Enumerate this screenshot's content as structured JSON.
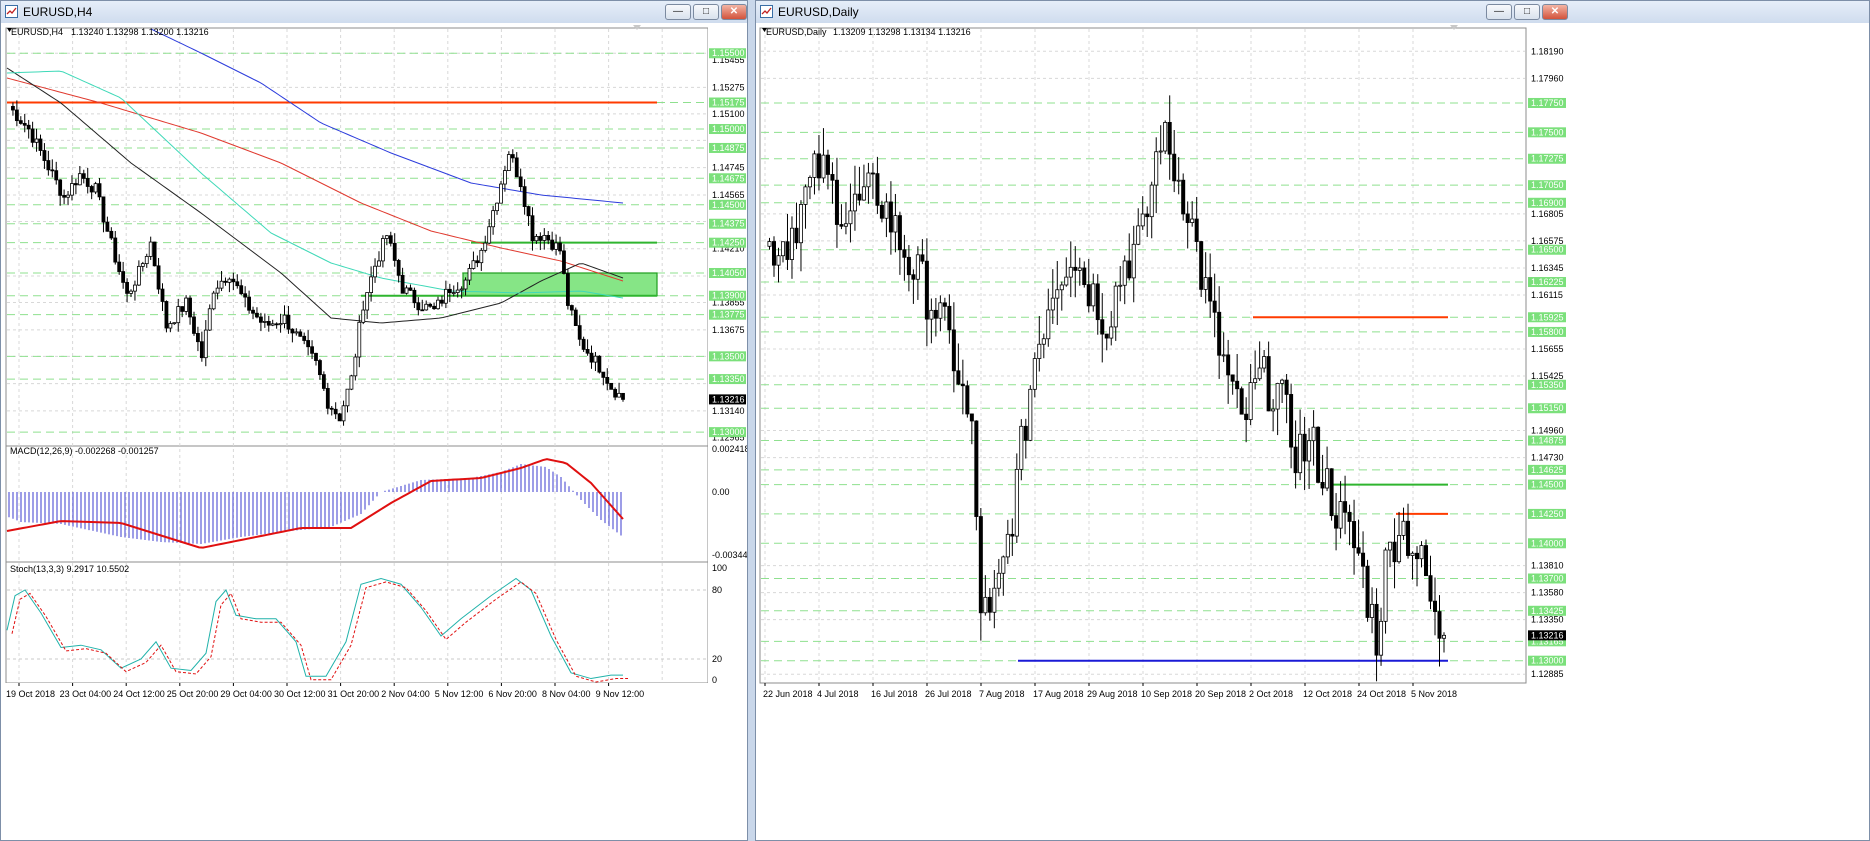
{
  "left": {
    "window_title": "EURUSD,H4",
    "header_symbol": "EURUSD,H4",
    "header_ohlc": "1.13240 1.13298 1.13200 1.13216",
    "macd_label": "MACD(12,26,9) -0.002268 -0.001257",
    "macd_scale": [
      "0.002418",
      "0.00",
      "-0.00344"
    ],
    "stoch_label": "Stoch(13,3,3) 9.2917 10.5502",
    "stoch_scale": [
      "100",
      "80",
      "20",
      "0"
    ],
    "price_labels": [
      {
        "text": "1.15455",
        "kind": "plain",
        "price": 1.15455
      },
      {
        "text": "1.15275",
        "kind": "plain",
        "price": 1.15275
      },
      {
        "text": "1.15100",
        "kind": "plain",
        "price": 1.151
      },
      {
        "text": "1.14745",
        "kind": "plain",
        "price": 1.14745
      },
      {
        "text": "1.14565",
        "kind": "plain",
        "price": 1.14565
      },
      {
        "text": "1.14210",
        "kind": "plain",
        "price": 1.1421
      },
      {
        "text": "1.13855",
        "kind": "plain",
        "price": 1.13855
      },
      {
        "text": "1.13675",
        "kind": "plain",
        "price": 1.13675
      },
      {
        "text": "1.13140",
        "kind": "plain",
        "price": 1.1314
      },
      {
        "text": "1.12965",
        "kind": "plain",
        "price": 1.12965
      },
      {
        "text": "1.15500",
        "kind": "green",
        "price": 1.155
      },
      {
        "text": "1.15175",
        "kind": "green",
        "price": 1.15175
      },
      {
        "text": "1.15000",
        "kind": "green",
        "price": 1.15
      },
      {
        "text": "1.14875",
        "kind": "green",
        "price": 1.14875
      },
      {
        "text": "1.14675",
        "kind": "green",
        "price": 1.14675
      },
      {
        "text": "1.14500",
        "kind": "green",
        "price": 1.145
      },
      {
        "text": "1.14375",
        "kind": "green",
        "price": 1.14375
      },
      {
        "text": "1.14250",
        "kind": "green",
        "price": 1.1425
      },
      {
        "text": "1.14050",
        "kind": "green",
        "price": 1.1405
      },
      {
        "text": "1.13900",
        "kind": "green",
        "price": 1.139
      },
      {
        "text": "1.13775",
        "kind": "green",
        "price": 1.13775
      },
      {
        "text": "1.13500",
        "kind": "green",
        "price": 1.135
      },
      {
        "text": "1.13350",
        "kind": "green",
        "price": 1.1335
      },
      {
        "text": "1.13000",
        "kind": "green",
        "price": 1.13
      },
      {
        "text": "1.13216",
        "kind": "current",
        "price": 1.13216
      }
    ],
    "time_labels": [
      "19 Oct 2018",
      "23 Oct 04:00",
      "24 Oct 12:00",
      "25 Oct 20:00",
      "29 Oct 04:00",
      "30 Oct 12:00",
      "31 Oct 20:00",
      "2 Nov 04:00",
      "5 Nov 12:00",
      "6 Nov 20:00",
      "8 Nov 04:00",
      "9 Nov 12:00"
    ]
  },
  "right": {
    "window_title": "EURUSD,Daily",
    "header_symbol": "EURUSD,Daily",
    "header_ohlc": "1.13209 1.13298 1.13134 1.13216",
    "price_labels": [
      {
        "text": "1.18190",
        "kind": "plain",
        "price": 1.1819
      },
      {
        "text": "1.17960",
        "kind": "plain",
        "price": 1.1796
      },
      {
        "text": "1.16805",
        "kind": "plain",
        "price": 1.16805
      },
      {
        "text": "1.16575",
        "kind": "plain",
        "price": 1.16575
      },
      {
        "text": "1.16345",
        "kind": "plain",
        "price": 1.16345
      },
      {
        "text": "1.16115",
        "kind": "plain",
        "price": 1.16115
      },
      {
        "text": "1.15655",
        "kind": "plain",
        "price": 1.15655
      },
      {
        "text": "1.15425",
        "kind": "plain",
        "price": 1.15425
      },
      {
        "text": "1.14960",
        "kind": "plain",
        "price": 1.1496
      },
      {
        "text": "1.14730",
        "kind": "plain",
        "price": 1.1473
      },
      {
        "text": "1.13810",
        "kind": "plain",
        "price": 1.1381
      },
      {
        "text": "1.13580",
        "kind": "plain",
        "price": 1.1358
      },
      {
        "text": "1.13350",
        "kind": "plain",
        "price": 1.1335
      },
      {
        "text": "1.12885",
        "kind": "plain",
        "price": 1.12885
      },
      {
        "text": "1.17750",
        "kind": "green",
        "price": 1.1775
      },
      {
        "text": "1.17500",
        "kind": "green",
        "price": 1.175
      },
      {
        "text": "1.17275",
        "kind": "green",
        "price": 1.17275
      },
      {
        "text": "1.17050",
        "kind": "green",
        "price": 1.1705
      },
      {
        "text": "1.16900",
        "kind": "green",
        "price": 1.169
      },
      {
        "text": "1.16500",
        "kind": "green",
        "price": 1.165
      },
      {
        "text": "1.16225",
        "kind": "green",
        "price": 1.16225
      },
      {
        "text": "1.15925",
        "kind": "green",
        "price": 1.15925
      },
      {
        "text": "1.15800",
        "kind": "green",
        "price": 1.158
      },
      {
        "text": "1.15350",
        "kind": "green",
        "price": 1.1535
      },
      {
        "text": "1.15150",
        "kind": "green",
        "price": 1.1515
      },
      {
        "text": "1.14875",
        "kind": "green",
        "price": 1.14875
      },
      {
        "text": "1.14625",
        "kind": "green",
        "price": 1.14625
      },
      {
        "text": "1.14500",
        "kind": "green",
        "price": 1.145
      },
      {
        "text": "1.14250",
        "kind": "green",
        "price": 1.1425
      },
      {
        "text": "1.14000",
        "kind": "green",
        "price": 1.14
      },
      {
        "text": "1.13700",
        "kind": "green",
        "price": 1.137
      },
      {
        "text": "1.13425",
        "kind": "green",
        "price": 1.13425
      },
      {
        "text": "1.13165",
        "kind": "green",
        "price": 1.13165
      },
      {
        "text": "1.13000",
        "kind": "green",
        "price": 1.13
      },
      {
        "text": "1.13216",
        "kind": "current",
        "price": 1.13216
      }
    ],
    "time_labels": [
      "22 Jun 2018",
      "4 Jul 2018",
      "16 Jul 2018",
      "26 Jul 2018",
      "7 Aug 2018",
      "17 Aug 2018",
      "29 Aug 2018",
      "10 Sep 2018",
      "20 Sep 2018",
      "2 Oct 2018",
      "12 Oct 2018",
      "24 Oct 2018",
      "5 Nov 2018"
    ]
  },
  "colors": {
    "level_line": "#8fe08f",
    "label_green": "#7be07b",
    "resistance": "#ff3b00",
    "support_green": "#2fb52f",
    "support_blue": "#1a1ad6",
    "ma_blue": "#2c3cdc",
    "ma_red": "#e03a2f",
    "ma_black": "#222222",
    "ma_aqua": "#3fd9b8",
    "macd_hist": "#3b3bcf",
    "macd_signal": "#e01010",
    "stoch_main": "#20b2aa",
    "stoch_signal": "#e01010"
  }
}
